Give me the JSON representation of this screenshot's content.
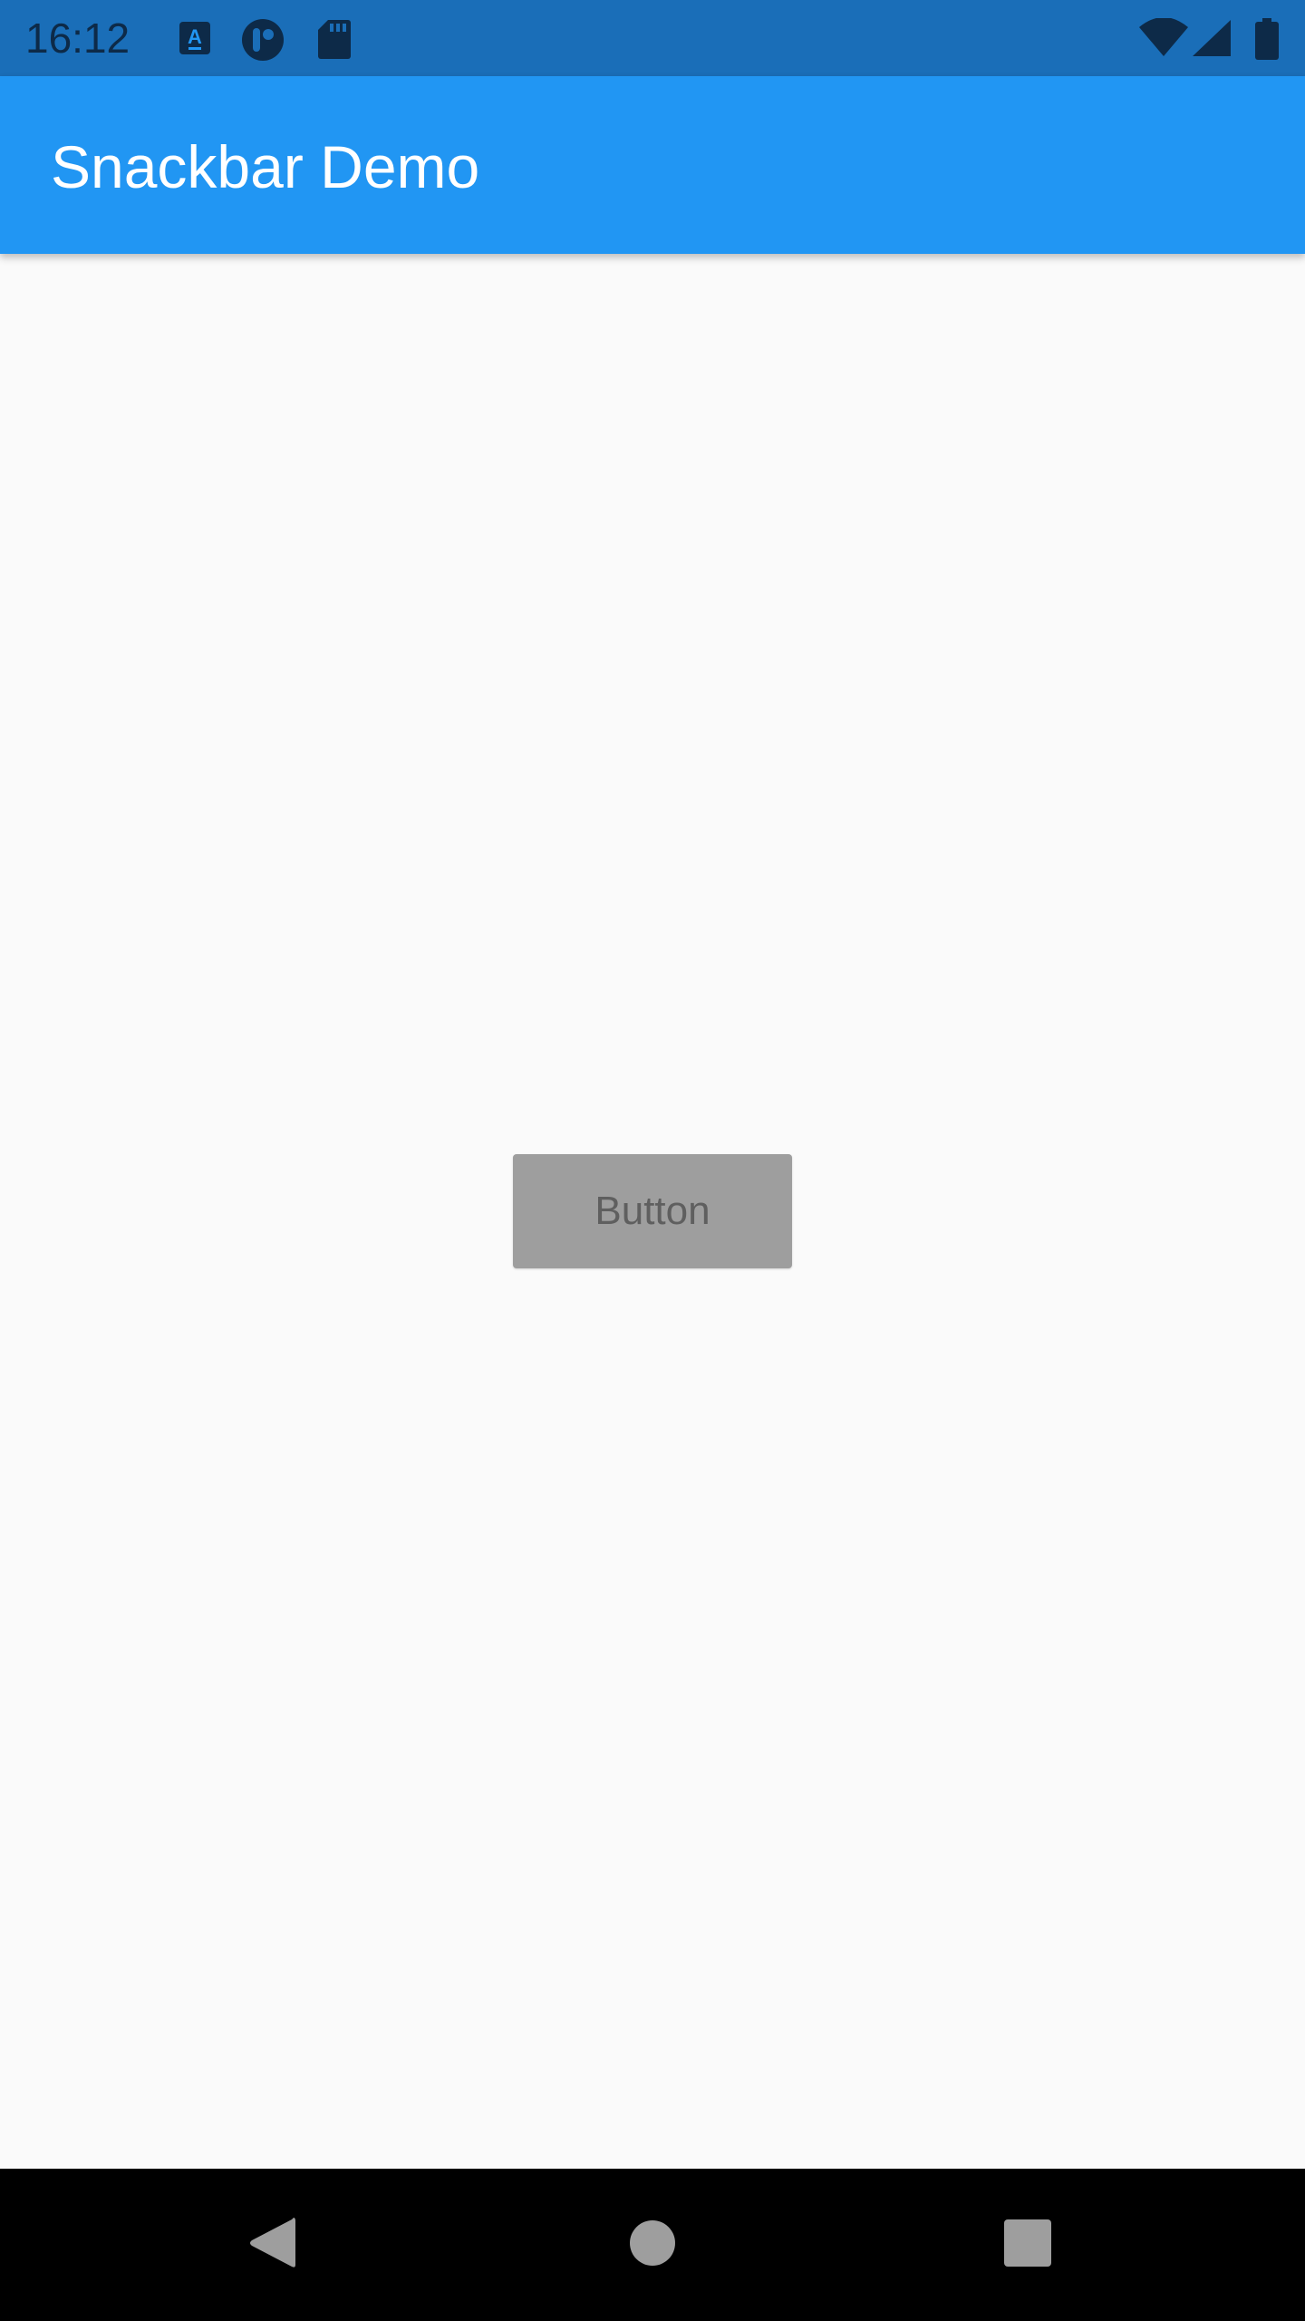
{
  "status_bar": {
    "time": "16:12",
    "icons": [
      "accessibility-a-icon",
      "ublock-icon",
      "sd-card-icon",
      "wifi-icon",
      "signal-icon",
      "battery-icon"
    ]
  },
  "app_bar": {
    "title": "Snackbar Demo"
  },
  "main": {
    "button_label": "Button"
  },
  "nav_bar": {
    "icons": [
      "back-icon",
      "home-icon",
      "recents-icon"
    ]
  },
  "colors": {
    "status_bar": "#1a6eb8",
    "app_bar": "#2196f3",
    "background": "#fafafa",
    "button": "#9e9e9e",
    "nav_bar": "#000000"
  }
}
